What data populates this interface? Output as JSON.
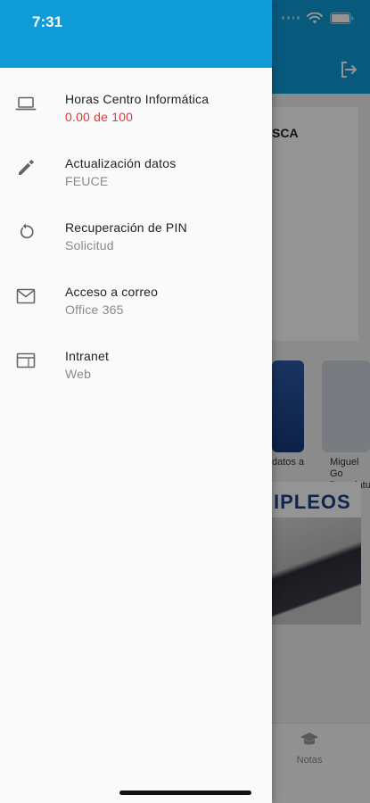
{
  "status_bar": {
    "time": "7:31"
  },
  "drawer": {
    "items": [
      {
        "icon": "laptop-icon",
        "title": "Horas Centro Informática",
        "subtitle": "0.00 de 100",
        "subtitle_color": "#e53935"
      },
      {
        "icon": "pencil-icon",
        "title": "Actualización datos",
        "subtitle": "FEUCE"
      },
      {
        "icon": "refresh-icon",
        "title": "Recuperación de PIN",
        "subtitle": "Solicitud"
      },
      {
        "icon": "mail-icon",
        "title": "Acceso a correo",
        "subtitle": "Office 365"
      },
      {
        "icon": "browser-window-icon",
        "title": "Intranet",
        "subtitle": "Web"
      }
    ]
  },
  "background": {
    "card_text": "SCA",
    "news_captions": [
      "datos a",
      "Miguel Go licenciatu"
    ],
    "empleos_title": "IPLEOS",
    "bottom_nav": {
      "label": "Notas",
      "icon": "graduation-cap-icon"
    }
  },
  "colors": {
    "primary": "#0e9bd8",
    "alert": "#e53935"
  }
}
